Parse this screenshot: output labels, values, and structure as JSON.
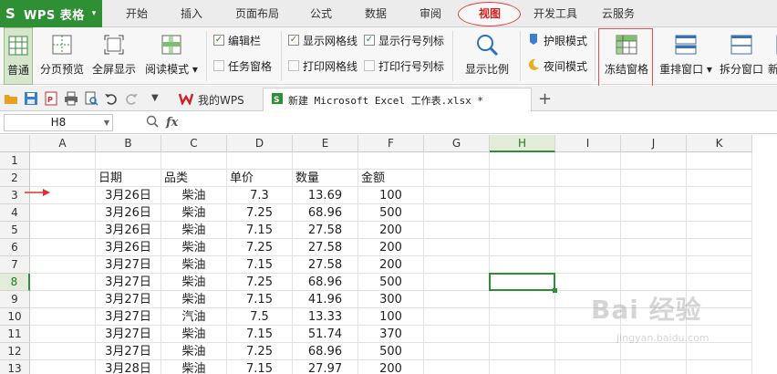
{
  "app": {
    "logo_char": "S",
    "title": "WPS 表格",
    "caret": "▾"
  },
  "menu": {
    "tabs": [
      {
        "label": "开始"
      },
      {
        "label": "插入"
      },
      {
        "label": "页面布局"
      },
      {
        "label": "公式"
      },
      {
        "label": "数据"
      },
      {
        "label": "审阅"
      },
      {
        "label": "视图",
        "active": true
      },
      {
        "label": "开发工具"
      },
      {
        "label": "云服务"
      }
    ]
  },
  "ribbon": {
    "normal": "普通",
    "page_preview": "分页预览",
    "fullscreen": "全屏显示",
    "reading_mode": "阅读模式",
    "edit_bar": "编辑栏",
    "task_pane": "任务窗格",
    "show_gridlines": "显示网格线",
    "print_gridlines": "打印网格线",
    "show_headers": "显示行号列标",
    "print_headers": "打印行号列标",
    "zoom": "显示比例",
    "eye_mode": "护眼模式",
    "night_mode": "夜间模式",
    "freeze_panes": "冻结窗格",
    "rearrange": "重排窗口",
    "split": "拆分窗口",
    "new_partial": "新"
  },
  "tabs_bar": {
    "wps_tab": "我的WPS",
    "doc_tab": "新建 Microsoft Excel 工作表.xlsx *",
    "new_tab": "+"
  },
  "formula_bar": {
    "cell_ref": "H8",
    "fx": "fx",
    "value": ""
  },
  "sheet": {
    "columns": [
      "A",
      "B",
      "C",
      "D",
      "E",
      "F",
      "G",
      "H",
      "I",
      "J",
      "K"
    ],
    "selected_column": "H",
    "selected_row": 8,
    "rows": [
      {
        "n": 1,
        "cells": [
          "",
          "",
          "",
          "",
          "",
          ""
        ]
      },
      {
        "n": 2,
        "cells": [
          "",
          "日期",
          "品类",
          "单价",
          "数量",
          "金额"
        ]
      },
      {
        "n": 3,
        "cells": [
          "",
          "3月26日",
          "柴油",
          "7.3",
          "13.69",
          "100"
        ]
      },
      {
        "n": 4,
        "cells": [
          "",
          "3月26日",
          "柴油",
          "7.25",
          "68.96",
          "500"
        ]
      },
      {
        "n": 5,
        "cells": [
          "",
          "3月26日",
          "柴油",
          "7.15",
          "27.58",
          "200"
        ]
      },
      {
        "n": 6,
        "cells": [
          "",
          "3月26日",
          "柴油",
          "7.25",
          "27.58",
          "200"
        ]
      },
      {
        "n": 7,
        "cells": [
          "",
          "3月27日",
          "柴油",
          "7.15",
          "27.58",
          "200"
        ]
      },
      {
        "n": 8,
        "cells": [
          "",
          "3月27日",
          "柴油",
          "7.25",
          "68.96",
          "500"
        ]
      },
      {
        "n": 9,
        "cells": [
          "",
          "3月27日",
          "柴油",
          "7.15",
          "41.96",
          "300"
        ]
      },
      {
        "n": 10,
        "cells": [
          "",
          "3月27日",
          "汽油",
          "7.5",
          "13.33",
          "100"
        ]
      },
      {
        "n": 11,
        "cells": [
          "",
          "3月27日",
          "柴油",
          "7.15",
          "51.74",
          "370"
        ]
      },
      {
        "n": 12,
        "cells": [
          "",
          "3月27日",
          "柴油",
          "7.25",
          "68.96",
          "500"
        ]
      },
      {
        "n": 13,
        "cells": [
          "",
          "3月28日",
          "柴油",
          "7.15",
          "27.97",
          "200"
        ]
      }
    ]
  },
  "watermark": {
    "line1": "Bai 经验",
    "line2": "jingyan.baidu.com"
  },
  "colors": {
    "brand_green": "#2f8f34",
    "highlight_red": "#e04040"
  }
}
